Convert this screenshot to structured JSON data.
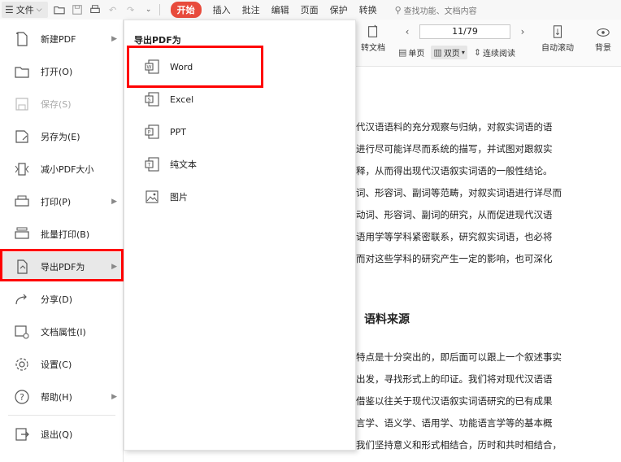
{
  "toolbar": {
    "file_label": "文件",
    "start_tab": "开始",
    "tabs": [
      "插入",
      "批注",
      "编辑",
      "页面",
      "保护",
      "转换"
    ],
    "search_placeholder": "查找功能、文档内容"
  },
  "ribbon": {
    "transfer_label": "转文档",
    "page_indicator": "11/79",
    "views": [
      "单页",
      "双页",
      "连续阅读"
    ],
    "auto_scroll": "自动滚动",
    "background": "背景"
  },
  "file_menu": {
    "items": [
      {
        "label": "新建PDF",
        "icon": "new-pdf-icon",
        "submenu": true,
        "disabled": false
      },
      {
        "label": "打开(O)",
        "icon": "folder-open-icon",
        "submenu": false,
        "disabled": false
      },
      {
        "label": "保存(S)",
        "icon": "save-icon",
        "submenu": false,
        "disabled": true
      },
      {
        "label": "另存为(E)",
        "icon": "save-as-icon",
        "submenu": false,
        "disabled": false
      },
      {
        "label": "减小PDF大小",
        "icon": "compress-icon",
        "submenu": false,
        "disabled": false
      },
      {
        "label": "打印(P)",
        "icon": "print-icon",
        "submenu": true,
        "disabled": false
      },
      {
        "label": "批量打印(B)",
        "icon": "batch-print-icon",
        "submenu": false,
        "disabled": false
      },
      {
        "label": "导出PDF为",
        "icon": "export-pdf-icon",
        "submenu": true,
        "disabled": false,
        "selected": true
      },
      {
        "label": "分享(D)",
        "icon": "share-icon",
        "submenu": false,
        "disabled": false
      },
      {
        "label": "文档属性(I)",
        "icon": "doc-properties-icon",
        "submenu": false,
        "disabled": false
      },
      {
        "label": "设置(C)",
        "icon": "settings-icon",
        "submenu": false,
        "disabled": false
      },
      {
        "label": "帮助(H)",
        "icon": "help-icon",
        "submenu": true,
        "disabled": false
      },
      {
        "label": "退出(Q)",
        "icon": "exit-icon",
        "submenu": false,
        "disabled": false
      }
    ]
  },
  "export_menu": {
    "title": "导出PDF为",
    "items": [
      {
        "label": "Word",
        "icon": "word-icon"
      },
      {
        "label": "Excel",
        "icon": "excel-icon"
      },
      {
        "label": "PPT",
        "icon": "ppt-icon"
      },
      {
        "label": "纯文本",
        "icon": "text-icon"
      },
      {
        "label": "图片",
        "icon": "image-icon"
      }
    ]
  },
  "document": {
    "lines": [
      "代汉语语料的充分观察与归纳，对叙实词语的语",
      "进行尽可能详尽而系统的描写，并试图对跟叙实",
      "释，从而得出现代汉语叙实词语的一般性结论。",
      "词、形容词、副词等范畴，对叙实词语进行详尽而",
      "动词、形容词、副词的研究，从而促进现代汉语",
      "语用学等学科紧密联系，研究叙实词语，也必将",
      "而对这些学科的研究产生一定的影响，也可深化"
    ],
    "heading": "语料来源",
    "lines2": [
      "特点是十分突出的，即后面可以跟上一个叙述事实",
      "出发，寻找形式上的印证。我们将对现代汉语语",
      "借鉴以往关于现代汉语叙实词语研究的已有成果",
      "言学、语义学、语用学、功能语言学等的基本概",
      "我们坚持意义和形式相结合，历时和共时相结合，"
    ]
  }
}
